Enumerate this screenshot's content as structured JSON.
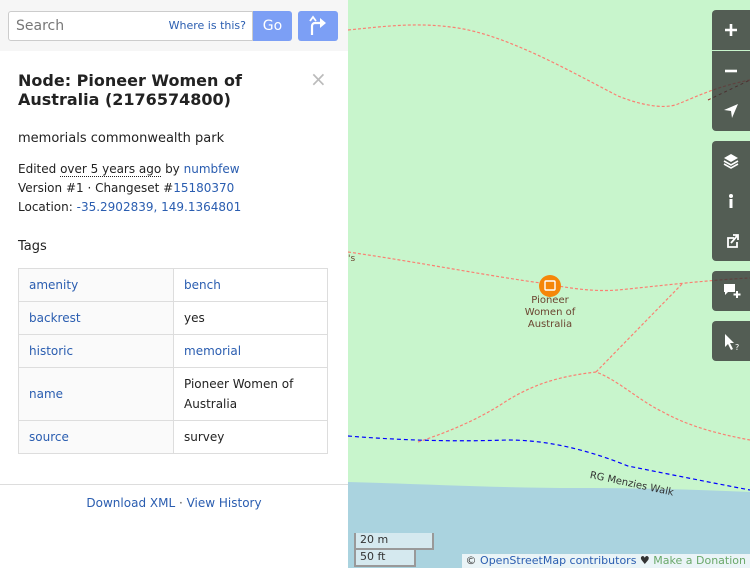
{
  "search": {
    "placeholder": "Search",
    "where_is_this": "Where is this?",
    "go_label": "Go"
  },
  "node": {
    "title": "Node: Pioneer Women of Australia (2176574800)",
    "close_symbol": "×",
    "description": "memorials commonwealth park",
    "edited_prefix": "Edited ",
    "edited_time": "over 5 years ago",
    "edited_by_word": " by ",
    "edited_user": "numbfew",
    "version_text": "Version #1 · Changeset #",
    "changeset": "15180370",
    "location_label": "Location: ",
    "location_value": "-35.2902839, 149.1364801",
    "tags_heading": "Tags",
    "tags": [
      {
        "key": "amenity",
        "value": "bench"
      },
      {
        "key": "backrest",
        "value": "yes"
      },
      {
        "key": "historic",
        "value": "memorial"
      },
      {
        "key": "name",
        "value": "Pioneer Women of Australia"
      },
      {
        "key": "source",
        "value": "survey"
      }
    ]
  },
  "footer": {
    "download_xml": "Download XML",
    "separator": " · ",
    "view_history": "View History"
  },
  "map": {
    "poi_label": "Pioneer Women of Australia",
    "road_label": "RG Menzies Walk",
    "edge_label": "'s",
    "scale_metric": "20 m",
    "scale_imperial": "50 ft",
    "attribution_prefix": "© ",
    "attribution_link": "OpenStreetMap contributors",
    "attribution_heart": " ♥ ",
    "attribution_donate": "Make a Donation",
    "colors": {
      "park": "#c8f5cc",
      "water": "#aad3df",
      "footway": "#fa8072",
      "boundary": "#0000ff",
      "poi": "#f5860a"
    }
  },
  "controls": [
    {
      "name": "zoom-in-icon"
    },
    {
      "name": "zoom-out-icon"
    },
    {
      "name": "locate-icon"
    },
    {
      "name": "layers-icon"
    },
    {
      "name": "info-icon"
    },
    {
      "name": "share-icon"
    },
    {
      "name": "add-note-icon"
    },
    {
      "name": "query-features-icon"
    }
  ]
}
